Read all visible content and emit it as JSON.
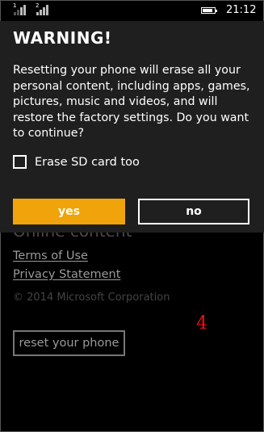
{
  "status_bar": {
    "sim1": "1",
    "sim2": "2",
    "time": "21:12",
    "icons": [
      "signal-sim1-icon",
      "signal-sim2-icon",
      "battery-icon"
    ]
  },
  "dialog": {
    "title": "WARNING!",
    "message": "Resetting your phone will erase all your personal content, including apps, games, pictures, music and videos, and will restore the factory settings. Do you want to continue?",
    "checkbox_label": "Erase SD card too",
    "checkbox_checked": false,
    "yes_label": "yes",
    "no_label": "no"
  },
  "background": {
    "heading": "Online content",
    "terms_link": "Terms of Use",
    "privacy_link": "Privacy Statement",
    "copyright": "© 2014 Microsoft Corporation",
    "reset_button": "reset your phone"
  },
  "annotation": "4",
  "colors": {
    "accent": "#f0a30a",
    "annotation": "#ee1111",
    "dialog_bg": "#1f1f1f"
  }
}
